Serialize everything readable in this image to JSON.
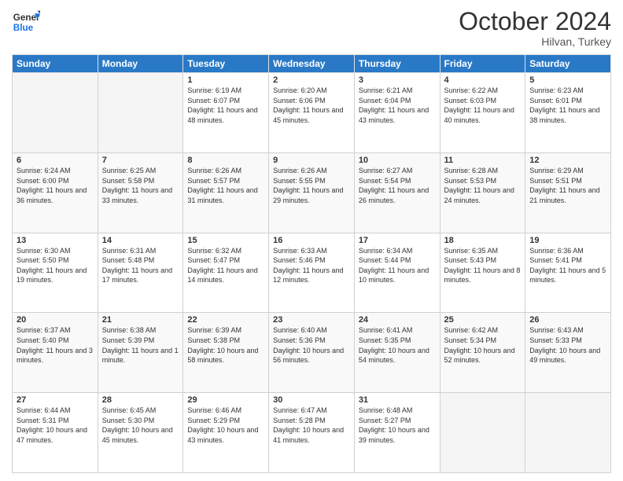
{
  "logo": {
    "line1": "General",
    "line2": "Blue"
  },
  "header": {
    "month": "October 2024",
    "location": "Hilvan, Turkey"
  },
  "weekdays": [
    "Sunday",
    "Monday",
    "Tuesday",
    "Wednesday",
    "Thursday",
    "Friday",
    "Saturday"
  ],
  "weeks": [
    [
      {
        "day": "",
        "sunrise": "",
        "sunset": "",
        "daylight": "",
        "empty": true
      },
      {
        "day": "",
        "sunrise": "",
        "sunset": "",
        "daylight": "",
        "empty": true
      },
      {
        "day": "1",
        "sunrise": "Sunrise: 6:19 AM",
        "sunset": "Sunset: 6:07 PM",
        "daylight": "Daylight: 11 hours and 48 minutes.",
        "empty": false
      },
      {
        "day": "2",
        "sunrise": "Sunrise: 6:20 AM",
        "sunset": "Sunset: 6:06 PM",
        "daylight": "Daylight: 11 hours and 45 minutes.",
        "empty": false
      },
      {
        "day": "3",
        "sunrise": "Sunrise: 6:21 AM",
        "sunset": "Sunset: 6:04 PM",
        "daylight": "Daylight: 11 hours and 43 minutes.",
        "empty": false
      },
      {
        "day": "4",
        "sunrise": "Sunrise: 6:22 AM",
        "sunset": "Sunset: 6:03 PM",
        "daylight": "Daylight: 11 hours and 40 minutes.",
        "empty": false
      },
      {
        "day": "5",
        "sunrise": "Sunrise: 6:23 AM",
        "sunset": "Sunset: 6:01 PM",
        "daylight": "Daylight: 11 hours and 38 minutes.",
        "empty": false
      }
    ],
    [
      {
        "day": "6",
        "sunrise": "Sunrise: 6:24 AM",
        "sunset": "Sunset: 6:00 PM",
        "daylight": "Daylight: 11 hours and 36 minutes.",
        "empty": false
      },
      {
        "day": "7",
        "sunrise": "Sunrise: 6:25 AM",
        "sunset": "Sunset: 5:58 PM",
        "daylight": "Daylight: 11 hours and 33 minutes.",
        "empty": false
      },
      {
        "day": "8",
        "sunrise": "Sunrise: 6:26 AM",
        "sunset": "Sunset: 5:57 PM",
        "daylight": "Daylight: 11 hours and 31 minutes.",
        "empty": false
      },
      {
        "day": "9",
        "sunrise": "Sunrise: 6:26 AM",
        "sunset": "Sunset: 5:55 PM",
        "daylight": "Daylight: 11 hours and 29 minutes.",
        "empty": false
      },
      {
        "day": "10",
        "sunrise": "Sunrise: 6:27 AM",
        "sunset": "Sunset: 5:54 PM",
        "daylight": "Daylight: 11 hours and 26 minutes.",
        "empty": false
      },
      {
        "day": "11",
        "sunrise": "Sunrise: 6:28 AM",
        "sunset": "Sunset: 5:53 PM",
        "daylight": "Daylight: 11 hours and 24 minutes.",
        "empty": false
      },
      {
        "day": "12",
        "sunrise": "Sunrise: 6:29 AM",
        "sunset": "Sunset: 5:51 PM",
        "daylight": "Daylight: 11 hours and 21 minutes.",
        "empty": false
      }
    ],
    [
      {
        "day": "13",
        "sunrise": "Sunrise: 6:30 AM",
        "sunset": "Sunset: 5:50 PM",
        "daylight": "Daylight: 11 hours and 19 minutes.",
        "empty": false
      },
      {
        "day": "14",
        "sunrise": "Sunrise: 6:31 AM",
        "sunset": "Sunset: 5:48 PM",
        "daylight": "Daylight: 11 hours and 17 minutes.",
        "empty": false
      },
      {
        "day": "15",
        "sunrise": "Sunrise: 6:32 AM",
        "sunset": "Sunset: 5:47 PM",
        "daylight": "Daylight: 11 hours and 14 minutes.",
        "empty": false
      },
      {
        "day": "16",
        "sunrise": "Sunrise: 6:33 AM",
        "sunset": "Sunset: 5:46 PM",
        "daylight": "Daylight: 11 hours and 12 minutes.",
        "empty": false
      },
      {
        "day": "17",
        "sunrise": "Sunrise: 6:34 AM",
        "sunset": "Sunset: 5:44 PM",
        "daylight": "Daylight: 11 hours and 10 minutes.",
        "empty": false
      },
      {
        "day": "18",
        "sunrise": "Sunrise: 6:35 AM",
        "sunset": "Sunset: 5:43 PM",
        "daylight": "Daylight: 11 hours and 8 minutes.",
        "empty": false
      },
      {
        "day": "19",
        "sunrise": "Sunrise: 6:36 AM",
        "sunset": "Sunset: 5:41 PM",
        "daylight": "Daylight: 11 hours and 5 minutes.",
        "empty": false
      }
    ],
    [
      {
        "day": "20",
        "sunrise": "Sunrise: 6:37 AM",
        "sunset": "Sunset: 5:40 PM",
        "daylight": "Daylight: 11 hours and 3 minutes.",
        "empty": false
      },
      {
        "day": "21",
        "sunrise": "Sunrise: 6:38 AM",
        "sunset": "Sunset: 5:39 PM",
        "daylight": "Daylight: 11 hours and 1 minute.",
        "empty": false
      },
      {
        "day": "22",
        "sunrise": "Sunrise: 6:39 AM",
        "sunset": "Sunset: 5:38 PM",
        "daylight": "Daylight: 10 hours and 58 minutes.",
        "empty": false
      },
      {
        "day": "23",
        "sunrise": "Sunrise: 6:40 AM",
        "sunset": "Sunset: 5:36 PM",
        "daylight": "Daylight: 10 hours and 56 minutes.",
        "empty": false
      },
      {
        "day": "24",
        "sunrise": "Sunrise: 6:41 AM",
        "sunset": "Sunset: 5:35 PM",
        "daylight": "Daylight: 10 hours and 54 minutes.",
        "empty": false
      },
      {
        "day": "25",
        "sunrise": "Sunrise: 6:42 AM",
        "sunset": "Sunset: 5:34 PM",
        "daylight": "Daylight: 10 hours and 52 minutes.",
        "empty": false
      },
      {
        "day": "26",
        "sunrise": "Sunrise: 6:43 AM",
        "sunset": "Sunset: 5:33 PM",
        "daylight": "Daylight: 10 hours and 49 minutes.",
        "empty": false
      }
    ],
    [
      {
        "day": "27",
        "sunrise": "Sunrise: 6:44 AM",
        "sunset": "Sunset: 5:31 PM",
        "daylight": "Daylight: 10 hours and 47 minutes.",
        "empty": false
      },
      {
        "day": "28",
        "sunrise": "Sunrise: 6:45 AM",
        "sunset": "Sunset: 5:30 PM",
        "daylight": "Daylight: 10 hours and 45 minutes.",
        "empty": false
      },
      {
        "day": "29",
        "sunrise": "Sunrise: 6:46 AM",
        "sunset": "Sunset: 5:29 PM",
        "daylight": "Daylight: 10 hours and 43 minutes.",
        "empty": false
      },
      {
        "day": "30",
        "sunrise": "Sunrise: 6:47 AM",
        "sunset": "Sunset: 5:28 PM",
        "daylight": "Daylight: 10 hours and 41 minutes.",
        "empty": false
      },
      {
        "day": "31",
        "sunrise": "Sunrise: 6:48 AM",
        "sunset": "Sunset: 5:27 PM",
        "daylight": "Daylight: 10 hours and 39 minutes.",
        "empty": false
      },
      {
        "day": "",
        "sunrise": "",
        "sunset": "",
        "daylight": "",
        "empty": true
      },
      {
        "day": "",
        "sunrise": "",
        "sunset": "",
        "daylight": "",
        "empty": true
      }
    ]
  ]
}
